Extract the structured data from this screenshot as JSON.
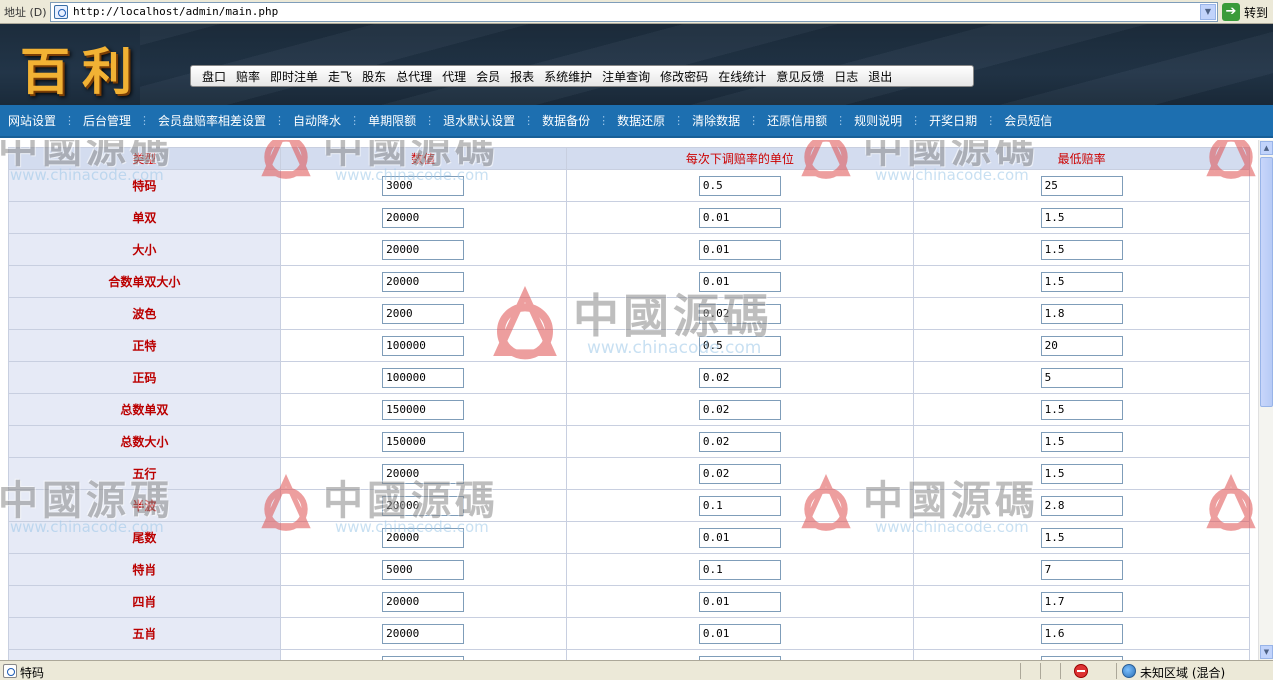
{
  "browser": {
    "address_label": "地址 (D)",
    "url": "http://localhost/admin/main.php",
    "go_label": "转到"
  },
  "header": {
    "logo_text": "百利",
    "nav": [
      "盘口",
      "赔率",
      "即时注单",
      "走飞",
      "股东",
      "总代理",
      "代理",
      "会员",
      "报表",
      "系统维护",
      "注单查询",
      "修改密码",
      "在线统计",
      "意见反馈",
      "日志",
      "退出"
    ]
  },
  "subnav": [
    "网站设置",
    "后台管理",
    "会员盘赔率相差设置",
    "自动降水",
    "单期限额",
    "退水默认设置",
    "数据备份",
    "数据还原",
    "清除数据",
    "还原信用额",
    "规则说明",
    "开奖日期",
    "会员短信"
  ],
  "table": {
    "headers": [
      "类型",
      "数值",
      "每次下调赔率的单位",
      "最低赔率"
    ],
    "rows": [
      {
        "type": "特码",
        "value": "3000",
        "unit": "0.5",
        "min": "25"
      },
      {
        "type": "单双",
        "value": "20000",
        "unit": "0.01",
        "min": "1.5"
      },
      {
        "type": "大小",
        "value": "20000",
        "unit": "0.01",
        "min": "1.5"
      },
      {
        "type": "合数单双大小",
        "value": "20000",
        "unit": "0.01",
        "min": "1.5"
      },
      {
        "type": "波色",
        "value": "2000",
        "unit": "0.02",
        "min": "1.8"
      },
      {
        "type": "正特",
        "value": "100000",
        "unit": "0.5",
        "min": "20"
      },
      {
        "type": "正码",
        "value": "100000",
        "unit": "0.02",
        "min": "5"
      },
      {
        "type": "总数单双",
        "value": "150000",
        "unit": "0.02",
        "min": "1.5"
      },
      {
        "type": "总数大小",
        "value": "150000",
        "unit": "0.02",
        "min": "1.5"
      },
      {
        "type": "五行",
        "value": "20000",
        "unit": "0.02",
        "min": "1.5"
      },
      {
        "type": "半波",
        "value": "20000",
        "unit": "0.1",
        "min": "2.8"
      },
      {
        "type": "尾数",
        "value": "20000",
        "unit": "0.01",
        "min": "1.5"
      },
      {
        "type": "特肖",
        "value": "5000",
        "unit": "0.1",
        "min": "7"
      },
      {
        "type": "四肖",
        "value": "20000",
        "unit": "0.01",
        "min": "1.7"
      },
      {
        "type": "五肖",
        "value": "20000",
        "unit": "0.01",
        "min": "1.6"
      },
      {
        "type": "",
        "value": "",
        "unit": "",
        "min": ""
      }
    ]
  },
  "watermark": {
    "text": "中國源碼",
    "url": "www.chinacode.com",
    "color": "#e05050"
  },
  "statusbar": {
    "text": "特码",
    "zone": "未知区域 (混合)"
  }
}
